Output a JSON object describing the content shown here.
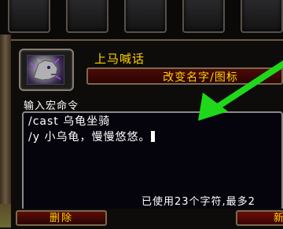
{
  "macro": {
    "name": "上马喊话",
    "icon": "wolf-head-icon",
    "rename_label": "改变名字/图标"
  },
  "editor": {
    "label": "输入宏命令",
    "lines": [
      "/cast 乌龟坐骑",
      "/y 小乌龟，慢慢悠悠。"
    ],
    "char_count": "已使用23个字符,最多2"
  },
  "buttons": {
    "delete_label": "删除",
    "new_label": "新"
  },
  "colors": {
    "title_gold": "#ffd100",
    "button_red": "#4c0a06",
    "arrow_green": "#1fd81a"
  }
}
